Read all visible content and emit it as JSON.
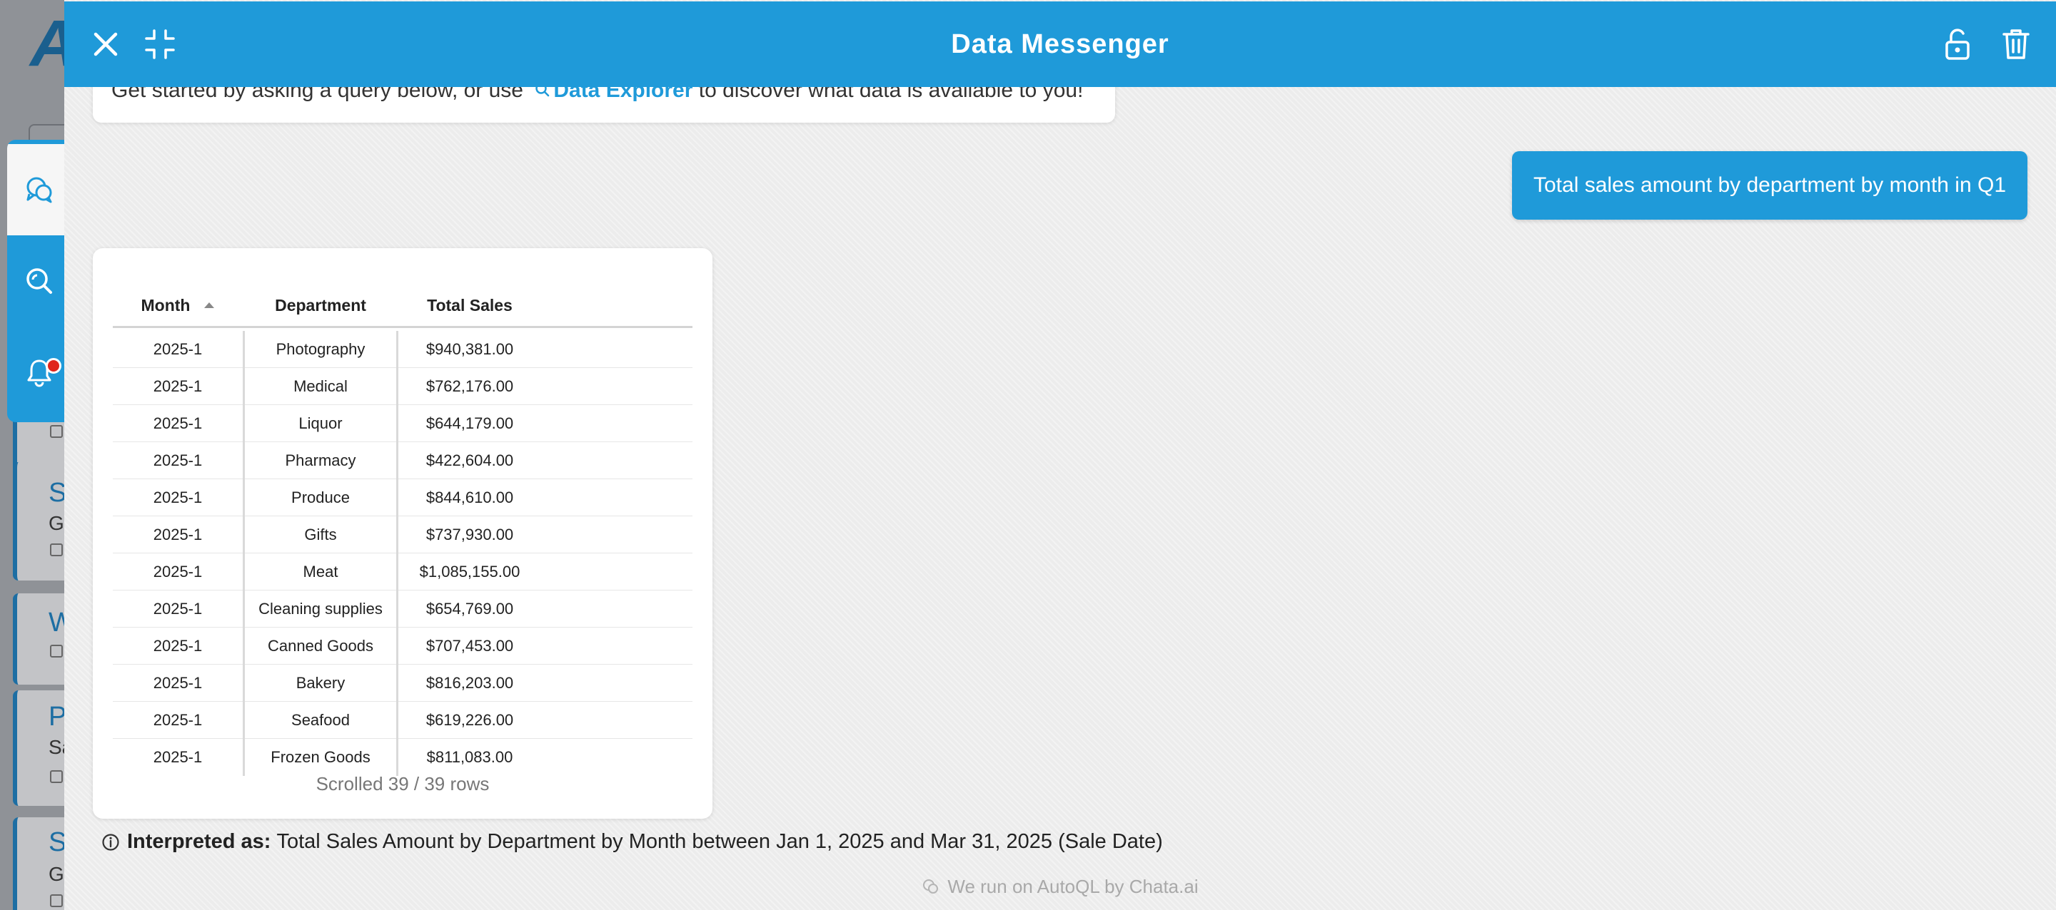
{
  "app": {
    "colors": {
      "brand": "#1f9ad9",
      "header_text": "#ffffff",
      "notification": "#e0251b"
    }
  },
  "background_app": {
    "logo_letter": "A",
    "cards": [
      {
        "title": "S",
        "subtitle": "Gi"
      },
      {
        "title": "W",
        "subtitle": ""
      },
      {
        "title": "P",
        "subtitle": "Sa"
      },
      {
        "title": "S",
        "subtitle": "Gi"
      }
    ]
  },
  "rail": {
    "items": [
      {
        "icon": "chat-bubbles-icon",
        "active": true
      },
      {
        "icon": "data-explorer-icon",
        "active": false
      },
      {
        "icon": "bell-icon",
        "active": false,
        "has_notification": true
      }
    ]
  },
  "header": {
    "title": "Data Messenger",
    "close_icon": "close-icon",
    "minimize_icon": "minimize-icon",
    "lock_icon": "lock-icon",
    "trash_icon": "trash-icon"
  },
  "welcome": {
    "text_before": "Get started by asking a query below, or use",
    "link_label": "Data Explorer",
    "text_after": "to discover what data is available to you!"
  },
  "user_query": "Total sales amount by department by month in Q1",
  "result_table": {
    "columns": [
      "Month",
      "Department",
      "Total Sales"
    ],
    "sort_column": "Month",
    "rows": [
      [
        "2025-1",
        "Photography",
        "$940,381.00"
      ],
      [
        "2025-1",
        "Medical",
        "$762,176.00"
      ],
      [
        "2025-1",
        "Liquor",
        "$644,179.00"
      ],
      [
        "2025-1",
        "Pharmacy",
        "$422,604.00"
      ],
      [
        "2025-1",
        "Produce",
        "$844,610.00"
      ],
      [
        "2025-1",
        "Gifts",
        "$737,930.00"
      ],
      [
        "2025-1",
        "Meat",
        "$1,085,155.00"
      ],
      [
        "2025-1",
        "Cleaning supplies",
        "$654,769.00"
      ],
      [
        "2025-1",
        "Canned Goods",
        "$707,453.00"
      ],
      [
        "2025-1",
        "Bakery",
        "$816,203.00"
      ],
      [
        "2025-1",
        "Seafood",
        "$619,226.00"
      ],
      [
        "2025-1",
        "Frozen Goods",
        "$811,083.00"
      ]
    ],
    "scroll_status": "Scrolled 39 / 39 rows"
  },
  "interpretation": {
    "label": "Interpreted as:",
    "text": "Total Sales Amount by Department by Month between Jan 1, 2025 and Mar 31, 2025 (Sale Date)"
  },
  "footer": {
    "text": "We run on AutoQL by Chata.ai"
  }
}
